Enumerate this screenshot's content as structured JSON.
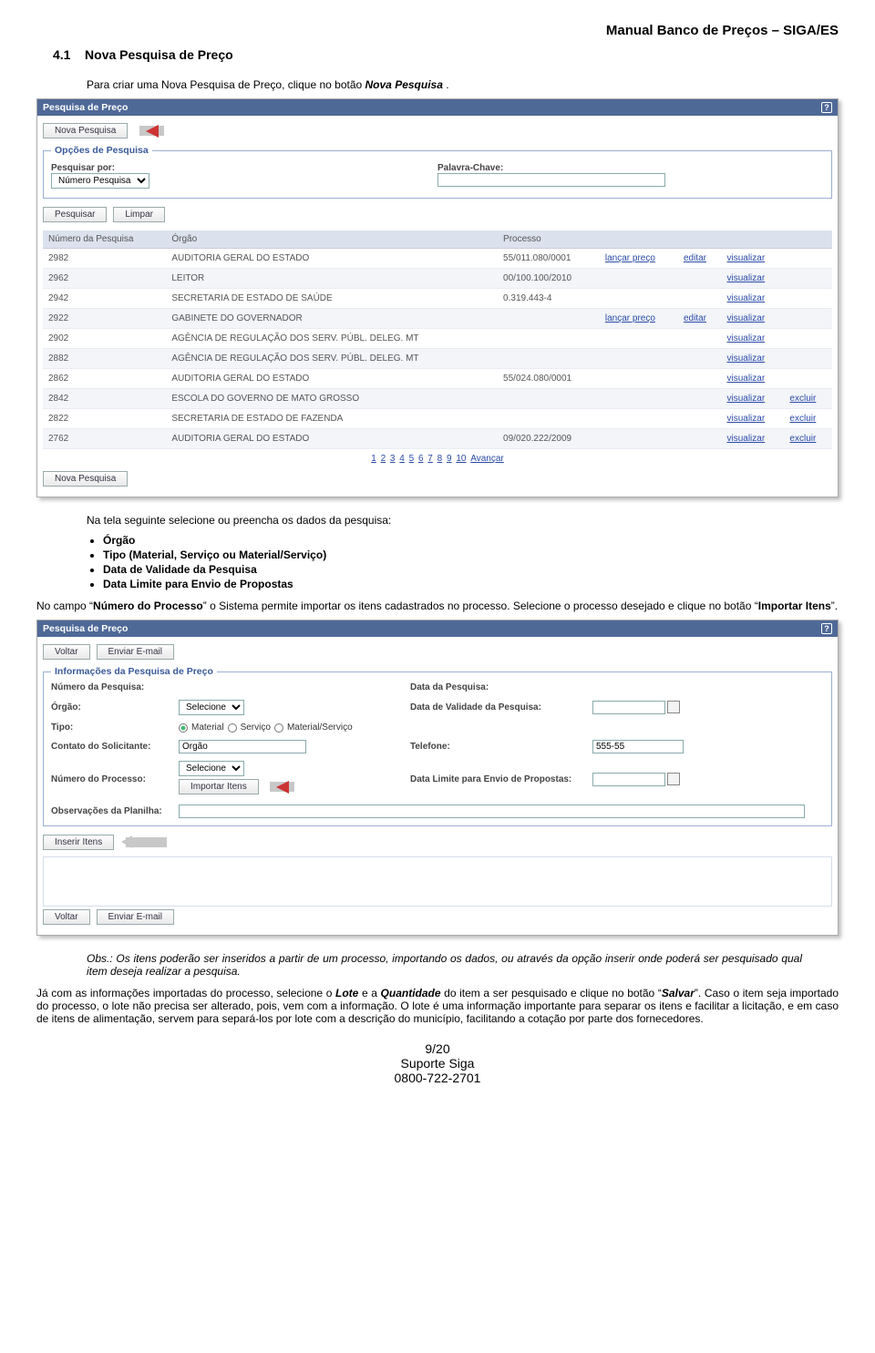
{
  "header": "Manual Banco de Preços – SIGA/ES",
  "section": {
    "number": "4.1",
    "title": "Nova Pesquisa de Preço"
  },
  "intro": {
    "pre": "Para criar uma Nova Pesquisa de Preço, clique no botão ",
    "em": "Nova Pesquisa",
    "post": "."
  },
  "shot1": {
    "title": "Pesquisa de Preço",
    "help": "?",
    "nova_btn": "Nova Pesquisa",
    "fs_title": "Opções de Pesquisa",
    "pesq_por_lbl": "Pesquisar por:",
    "pesq_por_val": "Número Pesquisa",
    "palavra_lbl": "Palavra-Chave:",
    "pesquisar_btn": "Pesquisar",
    "limpar_btn": "Limpar",
    "cols": {
      "num": "Número da Pesquisa",
      "orgao": "Órgão",
      "processo": "Processo"
    },
    "rows": [
      {
        "n": "2982",
        "o": "AUDITORIA GERAL DO ESTADO",
        "p": "55/011.080/0001",
        "a": [
          "lançar preço",
          "editar",
          "visualizar"
        ]
      },
      {
        "n": "2962",
        "o": "LEITOR",
        "p": "00/100.100/2010",
        "a": [
          "",
          "",
          "visualizar"
        ]
      },
      {
        "n": "2942",
        "o": "SECRETARIA DE ESTADO DE SAÚDE",
        "p": "0.319.443-4",
        "a": [
          "",
          "",
          "visualizar"
        ]
      },
      {
        "n": "2922",
        "o": "GABINETE DO GOVERNADOR",
        "p": "",
        "a": [
          "lançar preço",
          "editar",
          "visualizar"
        ]
      },
      {
        "n": "2902",
        "o": "AGÊNCIA DE REGULAÇÃO DOS SERV. PÚBL. DELEG. MT",
        "p": "",
        "a": [
          "",
          "",
          "visualizar"
        ]
      },
      {
        "n": "2882",
        "o": "AGÊNCIA DE REGULAÇÃO DOS SERV. PÚBL. DELEG. MT",
        "p": "",
        "a": [
          "",
          "",
          "visualizar"
        ]
      },
      {
        "n": "2862",
        "o": "AUDITORIA GERAL DO ESTADO",
        "p": "55/024.080/0001",
        "a": [
          "",
          "",
          "visualizar"
        ]
      },
      {
        "n": "2842",
        "o": "ESCOLA DO GOVERNO DE MATO GROSSO",
        "p": "",
        "a": [
          "",
          "",
          "visualizar",
          "excluir"
        ]
      },
      {
        "n": "2822",
        "o": "SECRETARIA DE ESTADO DE FAZENDA",
        "p": "",
        "a": [
          "",
          "",
          "visualizar",
          "excluir"
        ]
      },
      {
        "n": "2762",
        "o": "AUDITORIA GERAL DO ESTADO",
        "p": "09/020.222/2009",
        "a": [
          "",
          "",
          "visualizar",
          "excluir"
        ]
      }
    ],
    "pager": [
      "1",
      "2",
      "3",
      "4",
      "5",
      "6",
      "7",
      "8",
      "9",
      "10"
    ],
    "pager_next": "Avançar",
    "nova_btn2": "Nova Pesquisa"
  },
  "mid": {
    "lead": "Na tela seguinte selecione ou preencha os dados da pesquisa:",
    "bullets": [
      "Órgão",
      "Tipo (Material, Serviço ou Material/Serviço)",
      "Data de Validade da Pesquisa",
      "Data Limite para Envio de Propostas"
    ],
    "p2a": "No campo “",
    "p2b": "Número do Processo",
    "p2c": "” o Sistema permite importar os itens cadastrados no processo. Selecione o processo desejado e clique no botão “",
    "p2d": "Importar Itens",
    "p2e": "”."
  },
  "shot2": {
    "title": "Pesquisa de Preço",
    "help": "?",
    "voltar": "Voltar",
    "enviar": "Enviar E-mail",
    "fs_title": "Informações da Pesquisa de Preço",
    "num_lbl": "Número da Pesquisa:",
    "data_pesq_lbl": "Data da Pesquisa:",
    "orgao_lbl": "Órgão:",
    "orgao_val": "Selecione",
    "validade_lbl": "Data de Validade da Pesquisa:",
    "tipo_lbl": "Tipo:",
    "tipo_opts": [
      "Material",
      "Serviço",
      "Material/Serviço"
    ],
    "contato_lbl": "Contato do Solicitante:",
    "contato_val": "Orgão",
    "tel_lbl": "Telefone:",
    "tel_val": "555-55",
    "numproc_lbl": "Número do Processo:",
    "numproc_val": "Selecione",
    "importar_btn": "Importar Itens",
    "limite_lbl": "Data Limite para Envio de Propostas:",
    "obs_lbl": "Observações da Planilha:",
    "inserir_btn": "Inserir Itens"
  },
  "obs_text": "Obs.: Os itens poderão ser inseridos a partir de um processo, importando os dados, ou através da opção inserir onde poderá ser pesquisado qual item deseja realizar a pesquisa.",
  "final": {
    "p1a": "Já com as informações importadas do processo, selecione o ",
    "p1b": "Lote",
    "p1c": " e a ",
    "p1d": "Quantidade",
    "p1e": " do item a ser pesquisado e clique no botão “",
    "p1f": "Salvar",
    "p1g": "”. Caso o item seja importado do processo, o lote não precisa ser alterado, pois, vem com a informação. O lote é uma informação importante para separar os itens e facilitar a licitação, e em caso de itens de alimentação, servem para separá-los por lote com a descrição do município, facilitando a cotação por parte dos fornecedores."
  },
  "footer": {
    "page": "9/20",
    "l1": "Suporte Siga",
    "l2": "0800-722-2701"
  }
}
